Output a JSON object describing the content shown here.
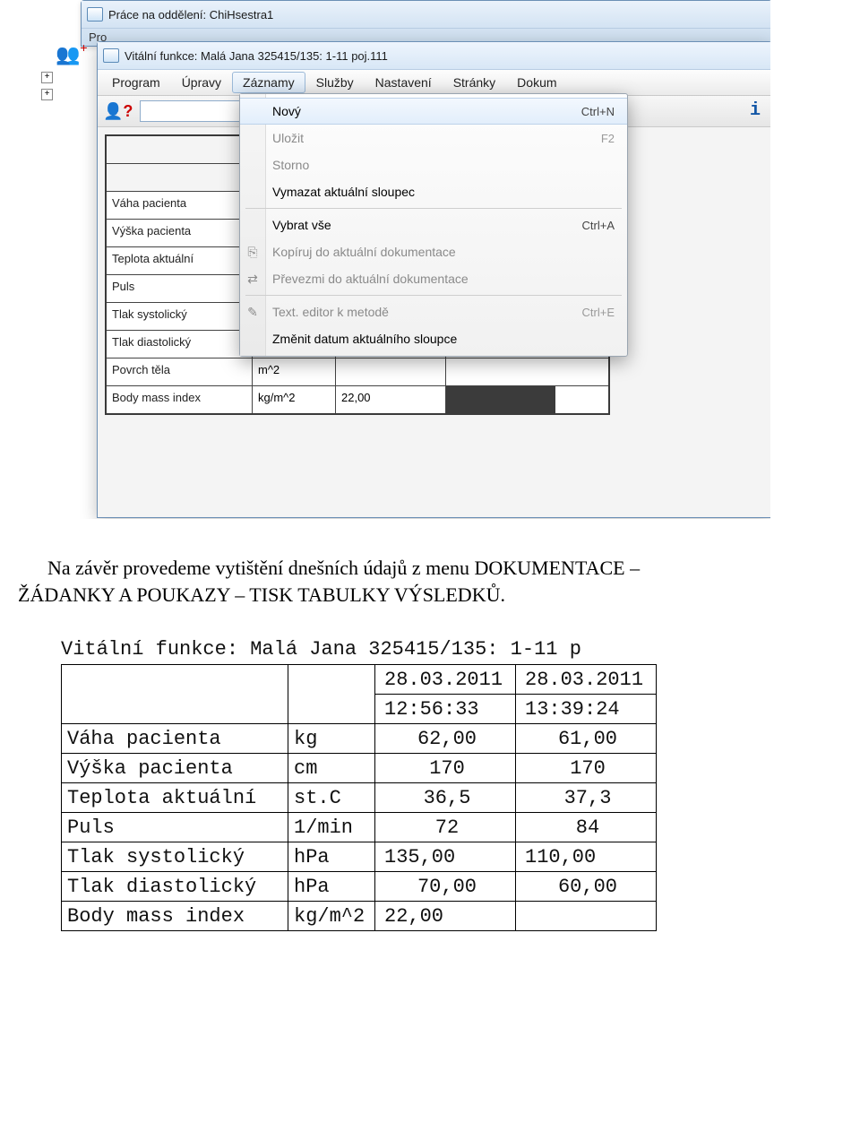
{
  "outerWindow": {
    "title": "Práce na oddělení: ChiHsestra1",
    "menubarFragment": "Pro"
  },
  "innerWindow": {
    "title": "Vitální funkce: Malá Jana 325415/135: 1-11 poj.111"
  },
  "menubar": {
    "items": [
      "Program",
      "Úpravy",
      "Záznamy",
      "Služby",
      "Nastavení",
      "Stránky",
      "Dokum"
    ],
    "activeIndex": 2
  },
  "toolbar": {
    "searchValue": "",
    "infoGlyph": "i"
  },
  "dropdown": {
    "items": [
      {
        "label": "Nový",
        "shortcut": "Ctrl+N",
        "hover": true
      },
      {
        "label": "Uložit",
        "shortcut": "F2",
        "disabled": true
      },
      {
        "label": "Storno",
        "disabled": true
      },
      {
        "label": "Vymazat aktuální sloupec"
      },
      {
        "sep": true
      },
      {
        "label": "Vybrat vše",
        "shortcut": "Ctrl+A"
      },
      {
        "label": "Kopíruj do aktuální dokumentace",
        "disabled": true,
        "icon": "copy"
      },
      {
        "label": "Převezmi do aktuální dokumentace",
        "disabled": true,
        "icon": "arrow"
      },
      {
        "sep": true
      },
      {
        "label": "Text. editor k metodě",
        "shortcut": "Ctrl+E",
        "disabled": true,
        "icon": "pen"
      },
      {
        "label": "Změnit datum aktuálního sloupce"
      }
    ]
  },
  "grid": {
    "rows": [
      {
        "label": "",
        "unit": "",
        "v1": "",
        "v2": ""
      },
      {
        "label": "",
        "unit": "",
        "v1": "",
        "v2": ""
      },
      {
        "label": "Váha pacienta",
        "unit": "",
        "v1": "",
        "v2": ""
      },
      {
        "label": "Výška pacienta",
        "unit": "",
        "v1": "",
        "v2": ""
      },
      {
        "label": "Teplota aktuální",
        "unit": "",
        "v1": "",
        "v2": ""
      },
      {
        "label": "Puls",
        "unit": "",
        "v1": "",
        "v2": ""
      },
      {
        "label": "Tlak systolický",
        "unit": "",
        "v1": "",
        "v2": ""
      },
      {
        "label": "Tlak diastolický",
        "unit": "",
        "v1": "",
        "v2": ""
      },
      {
        "label": "Povrch těla",
        "unit": "m^2",
        "v1": "",
        "v2": ""
      },
      {
        "label": "Body mass index",
        "unit": "kg/m^2",
        "v1": "22,00",
        "v2sel": true
      }
    ]
  },
  "docText": {
    "line1": "Na závěr provedeme vytištění dnešních údajů z menu DOKUMENTACE –",
    "line2": "ŽÁDANKY A POUKAZY – TISK TABULKY VÝSLEDKŮ."
  },
  "output": {
    "title": "Vitální funkce: Malá Jana 325415/135: 1-11 p",
    "headerDates": [
      "28.03.2011",
      "28.03.2011"
    ],
    "headerTimes": [
      "12:56:33",
      "13:39:24"
    ],
    "rows": [
      {
        "label": "Váha pacienta",
        "unit": "kg",
        "v1": "62,00",
        "v2": "61,00"
      },
      {
        "label": "Výška pacienta",
        "unit": "cm",
        "v1": "170",
        "v2": "170"
      },
      {
        "label": "Teplota aktuální",
        "unit": "st.C",
        "v1": "36,5",
        "v2": "37,3"
      },
      {
        "label": "Puls",
        "unit": "1/min",
        "v1": "72",
        "v2": "84"
      },
      {
        "label": "Tlak systolický",
        "unit": "hPa",
        "v1": "135,00",
        "v2": "110,00"
      },
      {
        "label": "Tlak diastolický",
        "unit": "hPa",
        "v1": "70,00",
        "v2": "60,00"
      },
      {
        "label": "Body mass index",
        "unit": "kg/m^2",
        "v1": "22,00",
        "v2": ""
      }
    ]
  },
  "chart_data": {
    "type": "table",
    "title": "Vitální funkce: Malá Jana 325415/135: 1-11",
    "columns": [
      "28.03.2011 12:56:33",
      "28.03.2011 13:39:24"
    ],
    "rows": [
      {
        "metric": "Váha pacienta",
        "unit": "kg",
        "values": [
          62.0,
          61.0
        ]
      },
      {
        "metric": "Výška pacienta",
        "unit": "cm",
        "values": [
          170,
          170
        ]
      },
      {
        "metric": "Teplota aktuální",
        "unit": "st.C",
        "values": [
          36.5,
          37.3
        ]
      },
      {
        "metric": "Puls",
        "unit": "1/min",
        "values": [
          72,
          84
        ]
      },
      {
        "metric": "Tlak systolický",
        "unit": "hPa",
        "values": [
          135.0,
          110.0
        ]
      },
      {
        "metric": "Tlak diastolický",
        "unit": "hPa",
        "values": [
          70.0,
          60.0
        ]
      },
      {
        "metric": "Body mass index",
        "unit": "kg/m^2",
        "values": [
          22.0,
          null
        ]
      }
    ]
  }
}
